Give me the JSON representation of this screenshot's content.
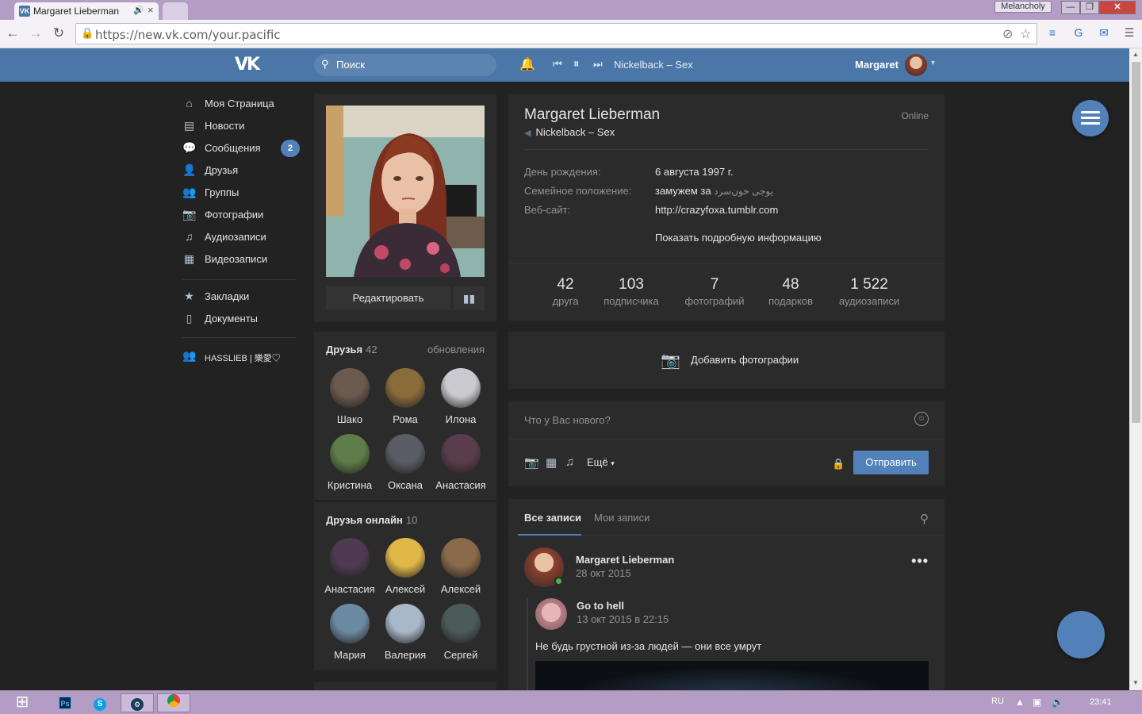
{
  "browser": {
    "tab_title": "Margaret Lieberman",
    "tab_favicon": "VK",
    "user_badge": "Melancholy",
    "url": "https://new.vk.com/your.pacific"
  },
  "header": {
    "logo": "VK",
    "search_placeholder": "Поиск",
    "now_playing": "Nickelback – Sex",
    "user_name": "Margaret"
  },
  "menu": {
    "items": [
      {
        "label": "Моя Страница",
        "icon": "home-icon"
      },
      {
        "label": "Новости",
        "icon": "news-icon"
      },
      {
        "label": "Сообщения",
        "icon": "messages-icon",
        "badge": "2"
      },
      {
        "label": "Друзья",
        "icon": "friend-icon"
      },
      {
        "label": "Группы",
        "icon": "groups-icon"
      },
      {
        "label": "Фотографии",
        "icon": "camera-icon"
      },
      {
        "label": "Аудиозаписи",
        "icon": "music-icon"
      },
      {
        "label": "Видеозаписи",
        "icon": "video-icon"
      }
    ],
    "secondary": [
      {
        "label": "Закладки",
        "icon": "star-icon"
      },
      {
        "label": "Документы",
        "icon": "document-icon"
      }
    ],
    "group": {
      "label": "HASSLIEB | 樂愛♡",
      "icon": "groups-icon"
    }
  },
  "profile_photo": {
    "edit_label": "Редактировать"
  },
  "friends": {
    "title": "Друзья",
    "count": "42",
    "link": "обновления",
    "list": [
      {
        "name": "Шако",
        "color": "#6b5a4e"
      },
      {
        "name": "Рома",
        "color": "#8a6b3a"
      },
      {
        "name": "Илона",
        "color": "#c9c9cf"
      },
      {
        "name": "Кристина",
        "color": "#5f7d4a"
      },
      {
        "name": "Оксана",
        "color": "#5a5d66"
      },
      {
        "name": "Анастасия",
        "color": "#5a3d4c"
      }
    ]
  },
  "friends_online": {
    "title": "Друзья онлайн",
    "count": "10",
    "list": [
      {
        "name": "Анастасия",
        "color": "#4e3b52"
      },
      {
        "name": "Алексей",
        "color": "#e0b84a"
      },
      {
        "name": "Алексей",
        "color": "#8a6a4a"
      },
      {
        "name": "Мария",
        "color": "#6d8aa3"
      },
      {
        "name": "Валерия",
        "color": "#a8b8c8"
      },
      {
        "name": "Сергей",
        "color": "#4d5a5a"
      }
    ]
  },
  "profile": {
    "name": "Margaret Lieberman",
    "online": "Online",
    "status": "Nickelback – Sex",
    "info": [
      {
        "label": "День рождения:",
        "value": "6 августа 1997 г."
      },
      {
        "label": "Семейное положение:",
        "value": "замужем за",
        "extra": "یوجی خون‌سرد"
      },
      {
        "label": "Веб-сайт:",
        "value": "http://crazyfoxa.tumblr.com"
      }
    ],
    "show_more": "Показать подробную информацию",
    "counters": [
      {
        "value": "42",
        "label": "друга"
      },
      {
        "value": "103",
        "label": "подписчика"
      },
      {
        "value": "7",
        "label": "фотографий"
      },
      {
        "value": "48",
        "label": "подарков"
      },
      {
        "value": "1 522",
        "label": "аудиозаписи"
      }
    ]
  },
  "add_photos": {
    "label": "Добавить фотографии"
  },
  "composer": {
    "placeholder": "Что у Вас нового?",
    "more_label": "Ещё",
    "send_label": "Отправить"
  },
  "wall": {
    "tab_all": "Все записи",
    "tab_mine": "Мои записи",
    "post": {
      "author": "Margaret Lieberman",
      "date": "28 окт 2015",
      "repost_author": "Go to hell",
      "repost_date": "13 окт 2015 в 22:15",
      "text": "Не будь грустной из-за людей — они все умрут"
    }
  },
  "taskbar": {
    "lang": "RU",
    "clock": "23:41",
    "ps_label": "Ps",
    "skype_label": "S"
  },
  "colors": {
    "accent": "#5181b8",
    "header": "#4a76a8",
    "background": "#222222",
    "card": "#2b2b2b",
    "window_frame": "#b39dc4"
  }
}
